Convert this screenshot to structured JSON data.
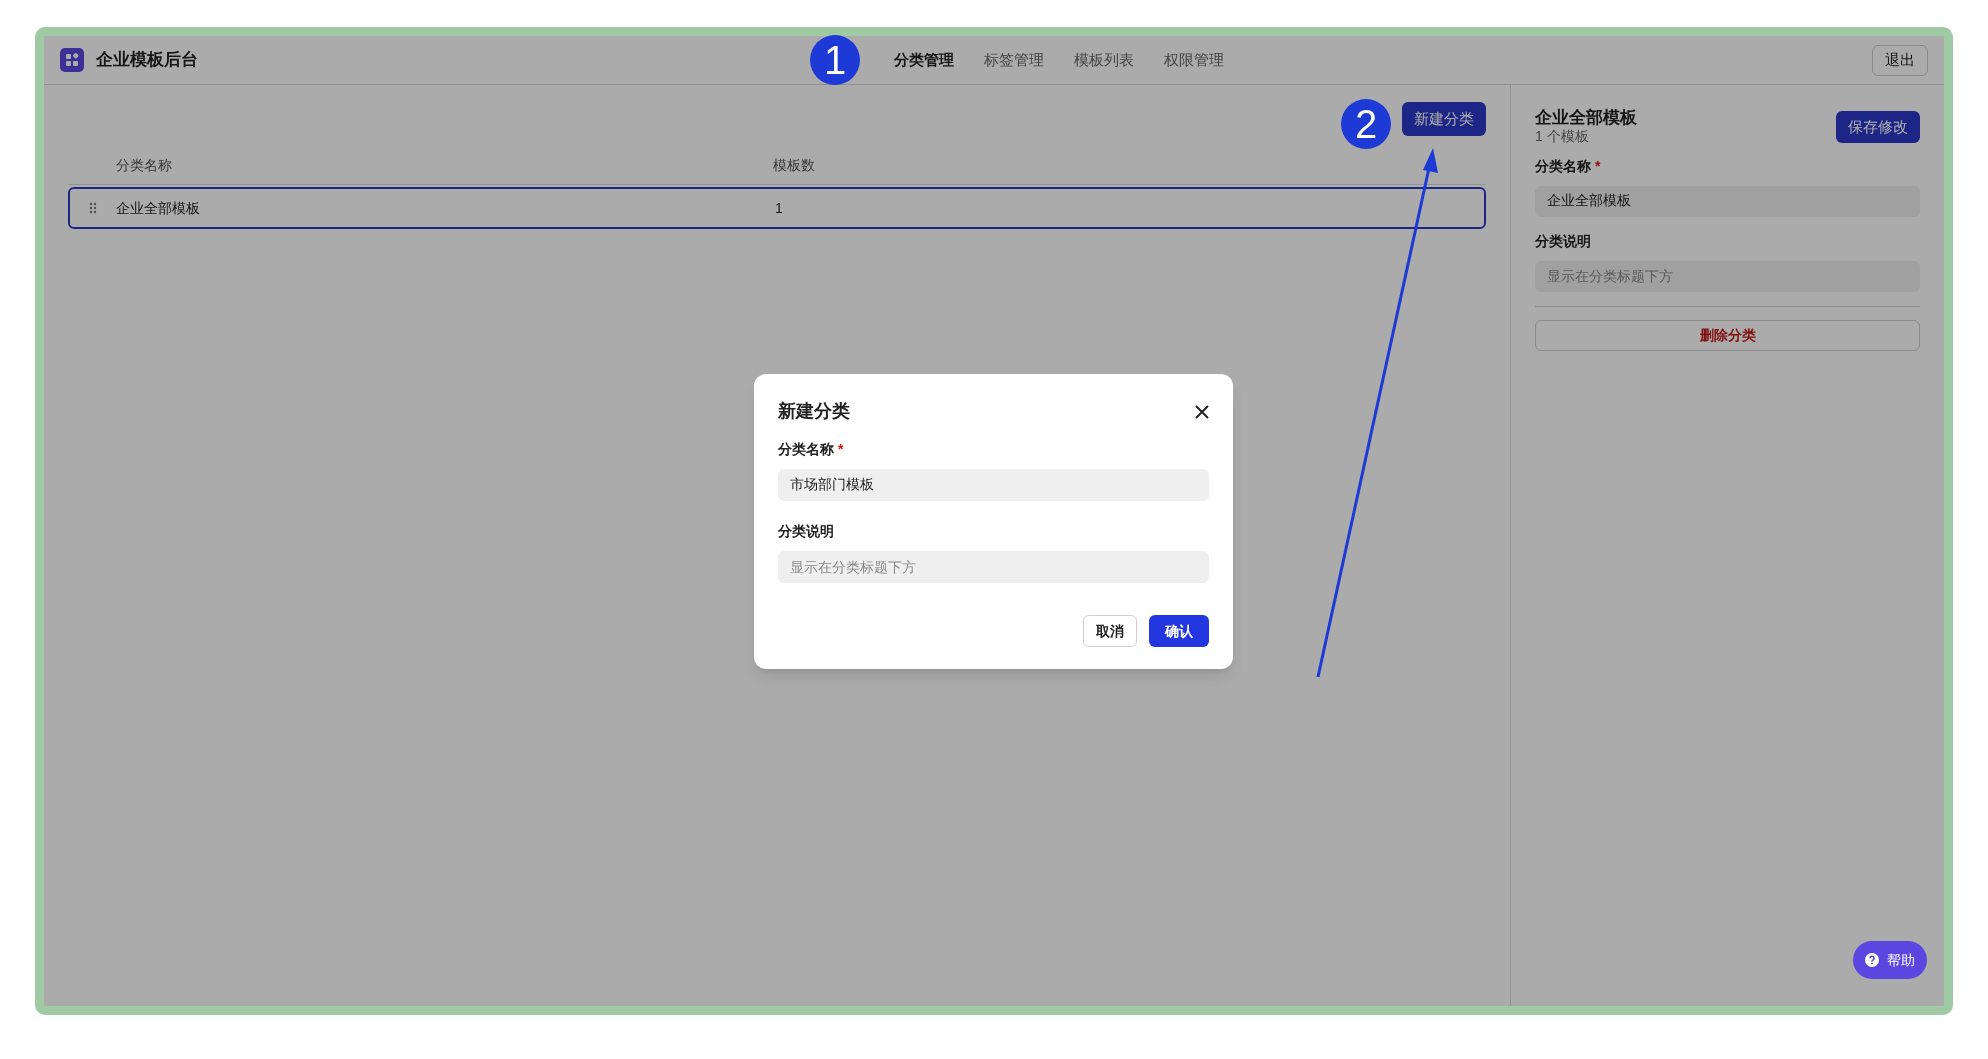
{
  "app": {
    "title": "企业模板后台"
  },
  "nav": [
    {
      "label": "分类管理",
      "selected": true
    },
    {
      "label": "标签管理",
      "selected": false
    },
    {
      "label": "模板列表",
      "selected": false
    },
    {
      "label": "权限管理",
      "selected": false
    }
  ],
  "logout_button": "退出",
  "toolbar": {
    "new_button": "新建分类"
  },
  "table": {
    "columns": [
      "分类名称",
      "模板数"
    ],
    "rows": [
      {
        "name": "企业全部模板",
        "count": "1",
        "selected": true
      }
    ]
  },
  "detail": {
    "title": "企业全部模板",
    "subtitle": "1 个模板",
    "save_button": "保存修改",
    "fields": [
      {
        "label": "分类名称",
        "required_mark": "*",
        "value": "企业全部模板"
      },
      {
        "label": "分类说明",
        "placeholder": "显示在分类标题下方"
      }
    ],
    "delete_button": "删除分类"
  },
  "dialog": {
    "title": "新建分类",
    "fields": [
      {
        "label": "分类名称",
        "required_mark": "*",
        "value": "市场部门模板"
      },
      {
        "label": "分类说明",
        "placeholder": "显示在分类标题下方"
      }
    ],
    "cancel_button": "取消",
    "confirm_button": "确认"
  },
  "help_button": "帮助",
  "annotations": [
    {
      "label": "1"
    },
    {
      "label": "2"
    }
  ]
}
